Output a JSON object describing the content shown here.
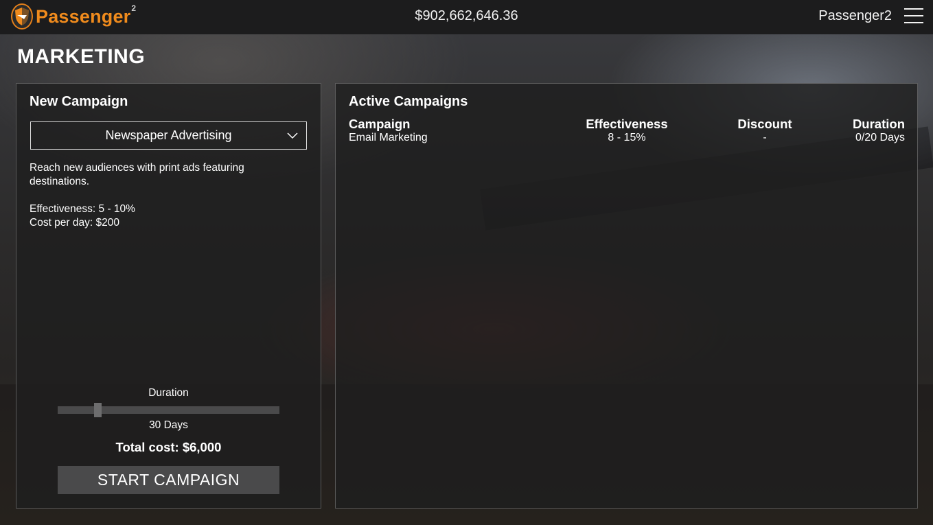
{
  "header": {
    "logo_text": "Passenger",
    "logo_superscript": "2",
    "balance": "$902,662,646.36",
    "username": "Passenger2",
    "menu_icon": "hamburger-menu-icon"
  },
  "page": {
    "title": "MARKETING"
  },
  "new_campaign": {
    "heading": "New Campaign",
    "selected_type": "Newspaper Advertising",
    "description": "Reach new audiences with print ads featuring destinations.",
    "effectiveness": "Effectiveness: 5 - 10%",
    "cost_per_day": "Cost per day: $200",
    "duration_label": "Duration",
    "duration_value": "30 Days",
    "duration_slider_fraction": 0.18,
    "total_cost": "Total cost: $6,000",
    "start_button": "START CAMPAIGN"
  },
  "active_campaigns": {
    "heading": "Active Campaigns",
    "columns": [
      "Campaign",
      "Effectiveness",
      "Discount",
      "Duration"
    ],
    "rows": [
      {
        "campaign": "Email Marketing",
        "effectiveness": "8 - 15%",
        "discount": "-",
        "duration": "0/20 Days"
      }
    ]
  },
  "colors": {
    "brand_orange": "#f08b1d",
    "panel_border": "#c8c8c8",
    "button_bg": "#4a4a4b"
  }
}
